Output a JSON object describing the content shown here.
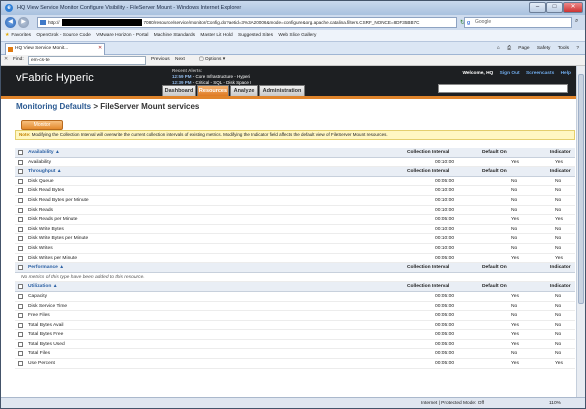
{
  "window": {
    "title": "HQ View Service Monitor Configure Visibility - FileServer Mount - Windows Internet Explorer",
    "url_prefix": "http://",
    "url_suffix": "7080/resource/service/monitor/Config.do?aetid=3%3A20006&mode=configure&org.apache.catalina.filters.CSRF_NONCE=8DF35BB7C",
    "search_placeholder": "Google"
  },
  "favorites": {
    "label": "Favorites",
    "items": [
      "OpenGrok - Source Code",
      "VMware Horizon - Portal",
      "Machine Standards",
      "Master Lit Hold",
      "Suggested Sites",
      "Web Slice Gallery"
    ]
  },
  "tabbar": {
    "tab_label": "HQ View Service Monit...",
    "commands": [
      "Page",
      "Safety",
      "Tools"
    ]
  },
  "find": {
    "label": "Find:",
    "value": "em-cs-te",
    "previous": "Previous",
    "next": "Next",
    "options": "Options"
  },
  "header": {
    "logo": "vFabric Hyperic",
    "alerts_label": "Recent Alerts:",
    "alerts": [
      {
        "time": "12:59 PM",
        "text": "- Core Infrastructure - Hyperi"
      },
      {
        "time": "12:39 PM",
        "text": "- Critical - SQL - Disk Space I"
      }
    ],
    "welcome": "Welcome, HQ",
    "links": [
      "Sign Out",
      "Screencasts",
      "Help"
    ],
    "nav_tabs": [
      "Dashboard",
      "Resources",
      "Analyze",
      "Administration"
    ]
  },
  "page": {
    "breadcrumb_link": "Monitoring Defaults",
    "breadcrumb_rest": " > FileServer Mount services",
    "button": "Monitor",
    "note_label": "Note:",
    "note_text": " Modifying the Collection Interval will overwrite the current collection intervals of existing metrics. Modifying the Indicator field affects the default view of FileServer Mount resources."
  },
  "columns": {
    "interval": "Collection Interval",
    "default_on": "Default On",
    "indicator": "Indicator"
  },
  "sections": [
    {
      "name": "Availability ▲",
      "rows": [
        {
          "name": "Availability",
          "interval": "00:10:00",
          "default_on": "Yes",
          "indicator": "Yes"
        }
      ]
    },
    {
      "name": "Throughput ▲",
      "rows": [
        {
          "name": "Disk Queue",
          "interval": "00:05:00",
          "default_on": "No",
          "indicator": "No"
        },
        {
          "name": "Disk Read Bytes",
          "interval": "00:10:00",
          "default_on": "No",
          "indicator": "No"
        },
        {
          "name": "Disk Read Bytes per Minute",
          "interval": "00:10:00",
          "default_on": "No",
          "indicator": "No"
        },
        {
          "name": "Disk Reads",
          "interval": "00:10:00",
          "default_on": "No",
          "indicator": "No"
        },
        {
          "name": "Disk Reads per Minute",
          "interval": "00:05:00",
          "default_on": "Yes",
          "indicator": "Yes"
        },
        {
          "name": "Disk Write Bytes",
          "interval": "00:10:00",
          "default_on": "No",
          "indicator": "No"
        },
        {
          "name": "Disk Write Bytes per Minute",
          "interval": "00:10:00",
          "default_on": "No",
          "indicator": "No"
        },
        {
          "name": "Disk Writes",
          "interval": "00:10:00",
          "default_on": "No",
          "indicator": "No"
        },
        {
          "name": "Disk Writes per Minute",
          "interval": "00:05:00",
          "default_on": "Yes",
          "indicator": "Yes"
        }
      ]
    },
    {
      "name": "Performance ▲",
      "empty": "No metrics of this type have been added to this resource.",
      "rows": []
    },
    {
      "name": "Utilization ▲",
      "rows": [
        {
          "name": "Capacity",
          "interval": "00:05:00",
          "default_on": "Yes",
          "indicator": "No"
        },
        {
          "name": "Disk Service Time",
          "interval": "00:05:00",
          "default_on": "No",
          "indicator": "No"
        },
        {
          "name": "Free Files",
          "interval": "00:05:00",
          "default_on": "No",
          "indicator": "No"
        },
        {
          "name": "Total Bytes Avail",
          "interval": "00:05:00",
          "default_on": "Yes",
          "indicator": "No"
        },
        {
          "name": "Total Bytes Free",
          "interval": "00:05:00",
          "default_on": "Yes",
          "indicator": "No"
        },
        {
          "name": "Total Bytes Used",
          "interval": "00:05:00",
          "default_on": "Yes",
          "indicator": "No"
        },
        {
          "name": "Total Files",
          "interval": "00:05:00",
          "default_on": "No",
          "indicator": "No"
        },
        {
          "name": "Use Percent",
          "interval": "00:05:00",
          "default_on": "Yes",
          "indicator": "Yes"
        }
      ]
    }
  ],
  "status": {
    "zone": "Internet | Protected Mode: Off",
    "zoom": "110%"
  }
}
